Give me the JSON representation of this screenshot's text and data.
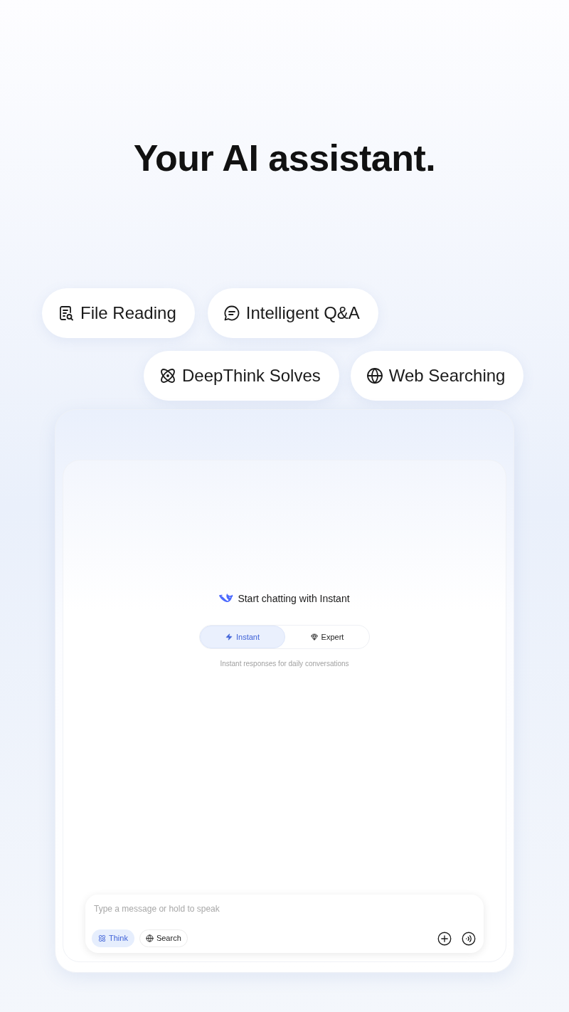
{
  "headline": "Your AI assistant.",
  "features": [
    {
      "label": "File Reading"
    },
    {
      "label": "Intelligent Q&A"
    },
    {
      "label": "DeepThink Solves"
    },
    {
      "label": "Web Searching"
    }
  ],
  "chat": {
    "greeting": "Start chatting with Instant",
    "modes": [
      {
        "label": "Instant",
        "selected": true
      },
      {
        "label": "Expert",
        "selected": false
      }
    ],
    "mode_hint": "Instant responses for daily conversations",
    "composer": {
      "placeholder": "Type a message or hold to speak",
      "toggles": [
        {
          "label": "Think",
          "selected": true
        },
        {
          "label": "Search",
          "selected": false
        }
      ]
    }
  }
}
